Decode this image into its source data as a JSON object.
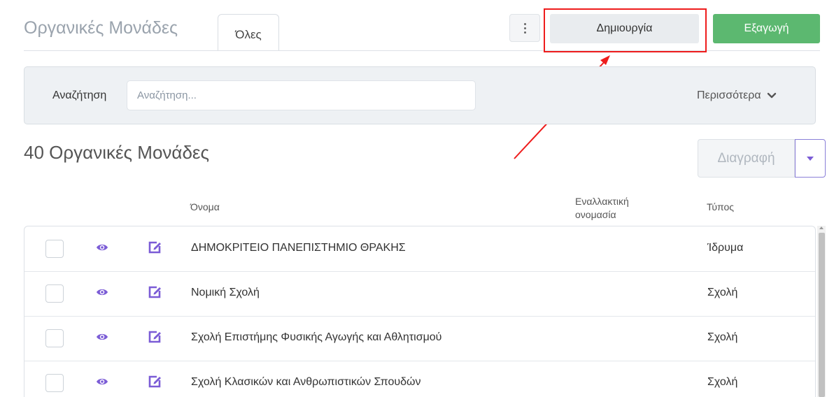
{
  "header": {
    "title": "Οργανικές Μονάδες",
    "tab_all": "Όλες",
    "create_label": "Δημιουργία",
    "export_label": "Εξαγωγή"
  },
  "search": {
    "label": "Αναζήτηση",
    "placeholder": "Αναζήτηση...",
    "value": "",
    "more_label": "Περισσότερα"
  },
  "list": {
    "count_title": "40 Οργανικές Μονάδες",
    "delete_label": "Διαγραφή",
    "columns": {
      "name": "Όνομα",
      "alt_name_line1": "Εναλλακτική",
      "alt_name_line2": "ονομασία",
      "type": "Τύπος"
    },
    "rows": [
      {
        "name": "ΔΗΜΟΚΡΙΤΕΙΟ ΠΑΝΕΠΙΣΤΗΜΙΟ ΘΡΑΚΗΣ",
        "alt_name": "",
        "type": "Ίδρυμα"
      },
      {
        "name": "Νομική Σχολή",
        "alt_name": "",
        "type": "Σχολή"
      },
      {
        "name": "Σχολή Επιστήμης Φυσικής Αγωγής και Αθλητισμού",
        "alt_name": "",
        "type": "Σχολή"
      },
      {
        "name": "Σχολή Κλασικών και Ανθρωπιστικών Σπουδών",
        "alt_name": "",
        "type": "Σχολή"
      }
    ]
  },
  "colors": {
    "accent_purple": "#7b5cd6",
    "export_green": "#5cb870",
    "annotation_red": "#ee1c1c"
  },
  "icons": {
    "kebab": "vertical-dots-icon",
    "more": "chevron-down-icon",
    "view": "eye-icon",
    "edit": "edit-icon",
    "delete_menu": "caret-down-icon"
  }
}
